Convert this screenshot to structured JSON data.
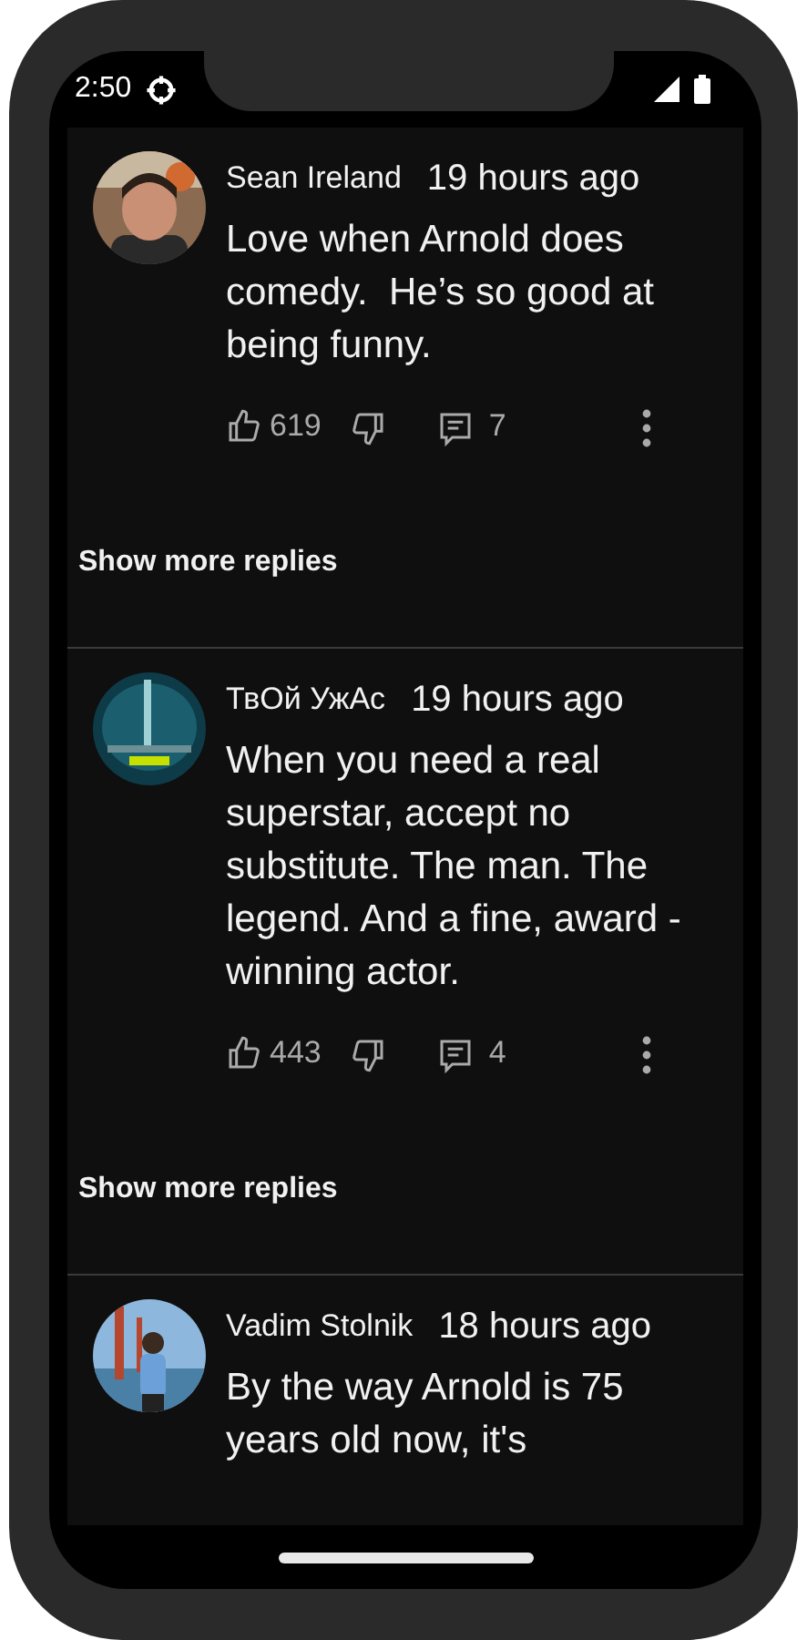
{
  "status_bar": {
    "time": "2:50"
  },
  "comments": [
    {
      "author": "Sean Ireland",
      "time": "19 hours ago",
      "text": "Love when Arnold does comedy.  He’s so good at being funny.",
      "likes": "619",
      "replies": "7",
      "show_more": "Show more replies"
    },
    {
      "author": "ТвОй УжАс",
      "time": "19 hours ago",
      "text": "When you need a real superstar, accept no substitute. The man. The legend. And a fine, award - winning actor.",
      "likes": "443",
      "replies": "4",
      "show_more": "Show more replies"
    },
    {
      "author": "Vadim Stolnik",
      "time": "18 hours ago",
      "text": "By the way Arnold is 75 years old now, it's"
    }
  ]
}
